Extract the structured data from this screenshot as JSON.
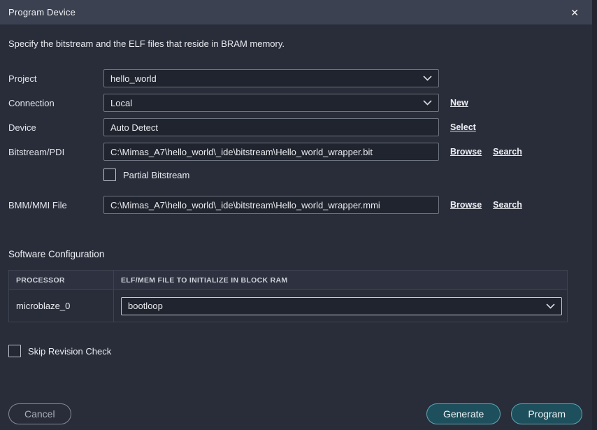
{
  "dialog": {
    "title": "Program Device",
    "description": "Specify the bitstream and the ELF files that reside in BRAM memory.",
    "close_icon": "✕"
  },
  "fields": {
    "project": {
      "label": "Project",
      "value": "hello_world"
    },
    "connection": {
      "label": "Connection",
      "value": "Local",
      "action": "New"
    },
    "device": {
      "label": "Device",
      "value": "Auto Detect",
      "action": "Select"
    },
    "bitstream": {
      "label": "Bitstream/PDI",
      "value": "C:\\Mimas_A7\\hello_world\\_ide\\bitstream\\Hello_world_wrapper.bit",
      "actions": [
        "Browse",
        "Search"
      ]
    },
    "partial_bitstream": {
      "label": "Partial Bitstream",
      "checked": false
    },
    "bmm_mmi": {
      "label": "BMM/MMI File",
      "value": "C:\\Mimas_A7\\hello_world\\_ide\\bitstream\\Hello_world_wrapper.mmi",
      "actions": [
        "Browse",
        "Search"
      ]
    }
  },
  "software_configuration": {
    "heading": "Software Configuration",
    "table": {
      "columns": [
        "PROCESSOR",
        "ELF/MEM FILE TO INITIALIZE IN BLOCK RAM"
      ],
      "rows": [
        {
          "processor": "microblaze_0",
          "elf_value": "bootloop"
        }
      ]
    }
  },
  "skip_revision": {
    "label": "Skip Revision Check",
    "checked": false
  },
  "footer": {
    "cancel_label": "Cancel",
    "generate_label": "Generate",
    "program_label": "Program"
  },
  "colors": {
    "titlebar": "#3b4150",
    "body_background": "#292d3a",
    "field_background": "#20242e",
    "accent_teal_fill": "#1d4f5c",
    "accent_teal_border": "#5fa7b5"
  }
}
